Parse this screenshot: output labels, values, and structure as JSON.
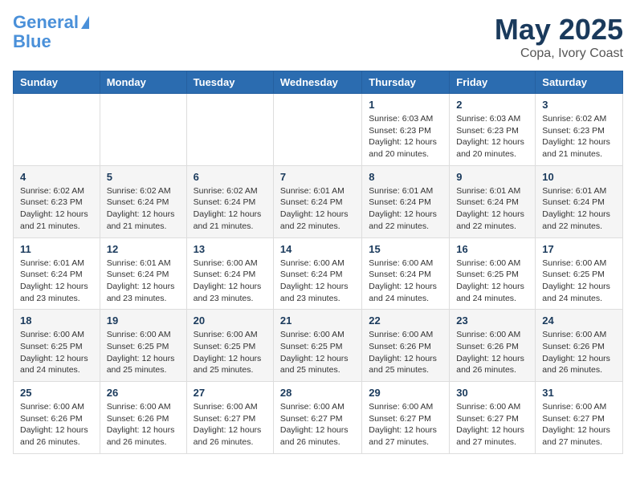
{
  "logo": {
    "line1": "General",
    "line2": "Blue"
  },
  "title": "May 2025",
  "location": "Copa, Ivory Coast",
  "days_of_week": [
    "Sunday",
    "Monday",
    "Tuesday",
    "Wednesday",
    "Thursday",
    "Friday",
    "Saturday"
  ],
  "weeks": [
    [
      {
        "day": "",
        "info": ""
      },
      {
        "day": "",
        "info": ""
      },
      {
        "day": "",
        "info": ""
      },
      {
        "day": "",
        "info": ""
      },
      {
        "day": "1",
        "info": "Sunrise: 6:03 AM\nSunset: 6:23 PM\nDaylight: 12 hours\nand 20 minutes."
      },
      {
        "day": "2",
        "info": "Sunrise: 6:03 AM\nSunset: 6:23 PM\nDaylight: 12 hours\nand 20 minutes."
      },
      {
        "day": "3",
        "info": "Sunrise: 6:02 AM\nSunset: 6:23 PM\nDaylight: 12 hours\nand 21 minutes."
      }
    ],
    [
      {
        "day": "4",
        "info": "Sunrise: 6:02 AM\nSunset: 6:23 PM\nDaylight: 12 hours\nand 21 minutes."
      },
      {
        "day": "5",
        "info": "Sunrise: 6:02 AM\nSunset: 6:24 PM\nDaylight: 12 hours\nand 21 minutes."
      },
      {
        "day": "6",
        "info": "Sunrise: 6:02 AM\nSunset: 6:24 PM\nDaylight: 12 hours\nand 21 minutes."
      },
      {
        "day": "7",
        "info": "Sunrise: 6:01 AM\nSunset: 6:24 PM\nDaylight: 12 hours\nand 22 minutes."
      },
      {
        "day": "8",
        "info": "Sunrise: 6:01 AM\nSunset: 6:24 PM\nDaylight: 12 hours\nand 22 minutes."
      },
      {
        "day": "9",
        "info": "Sunrise: 6:01 AM\nSunset: 6:24 PM\nDaylight: 12 hours\nand 22 minutes."
      },
      {
        "day": "10",
        "info": "Sunrise: 6:01 AM\nSunset: 6:24 PM\nDaylight: 12 hours\nand 22 minutes."
      }
    ],
    [
      {
        "day": "11",
        "info": "Sunrise: 6:01 AM\nSunset: 6:24 PM\nDaylight: 12 hours\nand 23 minutes."
      },
      {
        "day": "12",
        "info": "Sunrise: 6:01 AM\nSunset: 6:24 PM\nDaylight: 12 hours\nand 23 minutes."
      },
      {
        "day": "13",
        "info": "Sunrise: 6:00 AM\nSunset: 6:24 PM\nDaylight: 12 hours\nand 23 minutes."
      },
      {
        "day": "14",
        "info": "Sunrise: 6:00 AM\nSunset: 6:24 PM\nDaylight: 12 hours\nand 23 minutes."
      },
      {
        "day": "15",
        "info": "Sunrise: 6:00 AM\nSunset: 6:24 PM\nDaylight: 12 hours\nand 24 minutes."
      },
      {
        "day": "16",
        "info": "Sunrise: 6:00 AM\nSunset: 6:25 PM\nDaylight: 12 hours\nand 24 minutes."
      },
      {
        "day": "17",
        "info": "Sunrise: 6:00 AM\nSunset: 6:25 PM\nDaylight: 12 hours\nand 24 minutes."
      }
    ],
    [
      {
        "day": "18",
        "info": "Sunrise: 6:00 AM\nSunset: 6:25 PM\nDaylight: 12 hours\nand 24 minutes."
      },
      {
        "day": "19",
        "info": "Sunrise: 6:00 AM\nSunset: 6:25 PM\nDaylight: 12 hours\nand 25 minutes."
      },
      {
        "day": "20",
        "info": "Sunrise: 6:00 AM\nSunset: 6:25 PM\nDaylight: 12 hours\nand 25 minutes."
      },
      {
        "day": "21",
        "info": "Sunrise: 6:00 AM\nSunset: 6:25 PM\nDaylight: 12 hours\nand 25 minutes."
      },
      {
        "day": "22",
        "info": "Sunrise: 6:00 AM\nSunset: 6:26 PM\nDaylight: 12 hours\nand 25 minutes."
      },
      {
        "day": "23",
        "info": "Sunrise: 6:00 AM\nSunset: 6:26 PM\nDaylight: 12 hours\nand 26 minutes."
      },
      {
        "day": "24",
        "info": "Sunrise: 6:00 AM\nSunset: 6:26 PM\nDaylight: 12 hours\nand 26 minutes."
      }
    ],
    [
      {
        "day": "25",
        "info": "Sunrise: 6:00 AM\nSunset: 6:26 PM\nDaylight: 12 hours\nand 26 minutes."
      },
      {
        "day": "26",
        "info": "Sunrise: 6:00 AM\nSunset: 6:26 PM\nDaylight: 12 hours\nand 26 minutes."
      },
      {
        "day": "27",
        "info": "Sunrise: 6:00 AM\nSunset: 6:27 PM\nDaylight: 12 hours\nand 26 minutes."
      },
      {
        "day": "28",
        "info": "Sunrise: 6:00 AM\nSunset: 6:27 PM\nDaylight: 12 hours\nand 26 minutes."
      },
      {
        "day": "29",
        "info": "Sunrise: 6:00 AM\nSunset: 6:27 PM\nDaylight: 12 hours\nand 27 minutes."
      },
      {
        "day": "30",
        "info": "Sunrise: 6:00 AM\nSunset: 6:27 PM\nDaylight: 12 hours\nand 27 minutes."
      },
      {
        "day": "31",
        "info": "Sunrise: 6:00 AM\nSunset: 6:27 PM\nDaylight: 12 hours\nand 27 minutes."
      }
    ]
  ]
}
